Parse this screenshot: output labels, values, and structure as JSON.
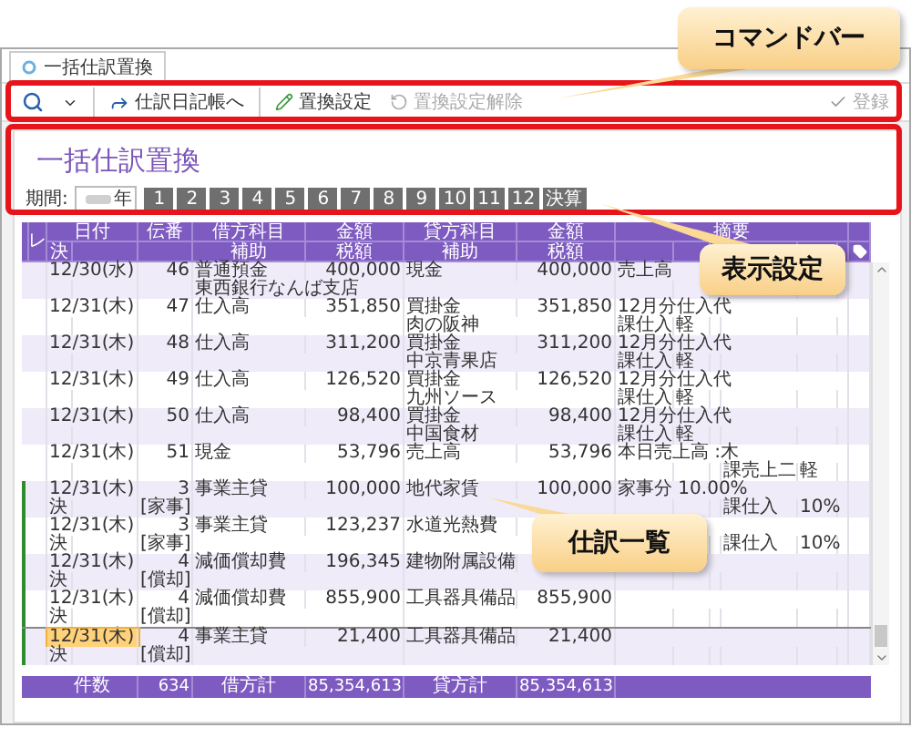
{
  "tab": {
    "title": "一括仕訳置換"
  },
  "toolbar": [
    {
      "kind": "search",
      "disabled": false
    },
    {
      "kind": "journal",
      "label": "仕訳日記帳へ",
      "disabled": false
    },
    {
      "kind": "replace",
      "label": "置換設定",
      "disabled": false
    },
    {
      "kind": "undo",
      "label": "置換設定解除",
      "disabled": true
    },
    {
      "kind": "save",
      "label": "登録",
      "disabled": true
    }
  ],
  "page_title": "一括仕訳置換",
  "period": {
    "label": "期間:",
    "year": "年",
    "months": [
      "1",
      "2",
      "3",
      "4",
      "5",
      "6",
      "7",
      "8",
      "9",
      "10",
      "11",
      "12",
      "決算"
    ]
  },
  "table": {
    "columns": {
      "check": "レ",
      "date": "日付",
      "settlement": "決",
      "no": "伝番",
      "debit": "借方科目",
      "debit_sub": "補助",
      "debit_amount": "金額",
      "debit_tax": "税額",
      "credit": "貸方科目",
      "credit_sub": "補助",
      "credit_amount": "金額",
      "credit_tax": "税額",
      "memo": "摘要"
    },
    "rows": [
      {
        "date": "12/30(水)",
        "no": "46",
        "debit": "普通預金",
        "debit_amount": "400,000",
        "credit": "現金",
        "credit_amount": "400,000",
        "memo": "売上高",
        "debit_sub": "東西銀行なんば支店",
        "linked": false,
        "selected": false
      },
      {
        "date": "12/31(木)",
        "no": "47",
        "debit": "仕入高",
        "debit_amount": "351,850",
        "credit": "買掛金",
        "credit_amount": "351,850",
        "memo": "12月分仕入代",
        "credit_sub": "肉の阪神",
        "debit_tax": {
          "class": "課仕入",
          "rate": "軽"
        },
        "linked": false,
        "selected": false
      },
      {
        "date": "12/31(木)",
        "no": "48",
        "debit": "仕入高",
        "debit_amount": "311,200",
        "credit": "買掛金",
        "credit_amount": "311,200",
        "memo": "12月分仕入代",
        "credit_sub": "中京青果店",
        "debit_tax": {
          "class": "課仕入",
          "rate": "軽"
        },
        "linked": false,
        "selected": false
      },
      {
        "date": "12/31(木)",
        "no": "49",
        "debit": "仕入高",
        "debit_amount": "126,520",
        "credit": "買掛金",
        "credit_amount": "126,520",
        "memo": "12月分仕入代",
        "credit_sub": "九州ソース",
        "debit_tax": {
          "class": "課仕入",
          "rate": "軽"
        },
        "linked": false,
        "selected": false
      },
      {
        "date": "12/31(木)",
        "no": "50",
        "debit": "仕入高",
        "debit_amount": "98,400",
        "credit": "買掛金",
        "credit_amount": "98,400",
        "memo": "12月分仕入代",
        "credit_sub": "中国食材",
        "debit_tax": {
          "class": "課仕入",
          "rate": "軽"
        },
        "linked": false,
        "selected": false
      },
      {
        "date": "12/31(木)",
        "no": "51",
        "debit": "現金",
        "debit_amount": "53,796",
        "credit": "売上高",
        "credit_amount": "53,796",
        "memo": "本日売上高 :木",
        "credit_tax": {
          "class": "課売上二",
          "rate": "軽"
        },
        "linked": false,
        "selected": false
      },
      {
        "date": "12/31(木)",
        "no": "3",
        "debit": "事業主貸",
        "debit_amount": "100,000",
        "credit": "地代家賃",
        "credit_amount": "100,000",
        "memo": "家事分 10.00%",
        "settlement": "決",
        "sub_no": "[家事]",
        "credit_tax": {
          "class": "課仕入",
          "rate": "10%"
        },
        "linked": true,
        "selected": false
      },
      {
        "date": "12/31(木)",
        "no": "3",
        "debit": "事業主貸",
        "debit_amount": "123,237",
        "credit": "水道光熱費",
        "settlement": "決",
        "sub_no": "[家事]",
        "credit_tax": {
          "class": "課仕入",
          "rate": "10%"
        },
        "linked": true,
        "selected": false
      },
      {
        "date": "12/31(木)",
        "no": "4",
        "debit": "減価償却費",
        "debit_amount": "196,345",
        "credit": "建物附属設備",
        "settlement": "決",
        "sub_no": "[償却]",
        "linked": true,
        "selected": false
      },
      {
        "date": "12/31(木)",
        "no": "4",
        "debit": "減価償却費",
        "debit_amount": "855,900",
        "credit": "工具器具備品",
        "credit_amount": "855,900",
        "settlement": "決",
        "sub_no": "[償却]",
        "linked": true,
        "selected": false
      },
      {
        "date": "12/31(木)",
        "no": "4",
        "debit": "事業主貸",
        "debit_amount": "21,400",
        "credit": "工具器具備品",
        "credit_amount": "21,400",
        "settlement": "決",
        "sub_no": "[償却]",
        "linked": true,
        "selected": true
      }
    ],
    "footer": {
      "count_label": "件数",
      "count": "634",
      "debit_label": "借方計",
      "debit_total": "85,354,613",
      "credit_label": "貸方計",
      "credit_total": "85,354,613"
    }
  },
  "callouts": [
    {
      "text": "コマンドバー"
    },
    {
      "text": "表示設定"
    },
    {
      "text": "仕訳一覧"
    }
  ]
}
